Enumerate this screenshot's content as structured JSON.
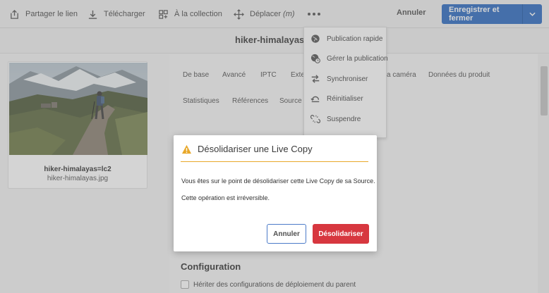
{
  "toolbar": {
    "share_link": "Partager le lien",
    "download": "Télécharger",
    "to_collection": "À la collection",
    "move": "Déplacer",
    "move_shortcut": "(m)",
    "cancel": "Annuler",
    "save_close": "Enregistrer et fermer"
  },
  "asset": {
    "title": "hiker-himalayas=",
    "card_name": "hiker-himalayas=lc2",
    "card_file": "hiker-himalayas.jpg"
  },
  "tabs": {
    "row1": [
      "De base",
      "Avancé",
      "IPTC",
      "Exte",
      "a caméra",
      "Données du produit"
    ],
    "row2": [
      "Statistiques",
      "Références",
      "Source c"
    ]
  },
  "menu": {
    "items": [
      {
        "label": "Publication rapide",
        "icon": "globe-icon"
      },
      {
        "label": "Gérer la publication",
        "icon": "globe-clock-icon"
      },
      {
        "label": "Synchroniser",
        "icon": "sync-arrows-icon"
      },
      {
        "label": "Réinitialiser",
        "icon": "reset-icon"
      },
      {
        "label": "Suspendre",
        "icon": "unlink-icon"
      }
    ]
  },
  "config": {
    "title": "Configuration",
    "inherit_label": "Hériter des configurations de déploiement du parent"
  },
  "dialog": {
    "title": "Désolidariser une Live Copy",
    "line1": "Vous êtes sur le point de désolidariser cette Live Copy de sa Source.",
    "line2": "Cette opération est irréversible.",
    "cancel": "Annuler",
    "confirm": "Désolidariser"
  },
  "colors": {
    "primary": "#2d6bc1",
    "danger": "#d7373f",
    "warning": "#e8a82a"
  }
}
